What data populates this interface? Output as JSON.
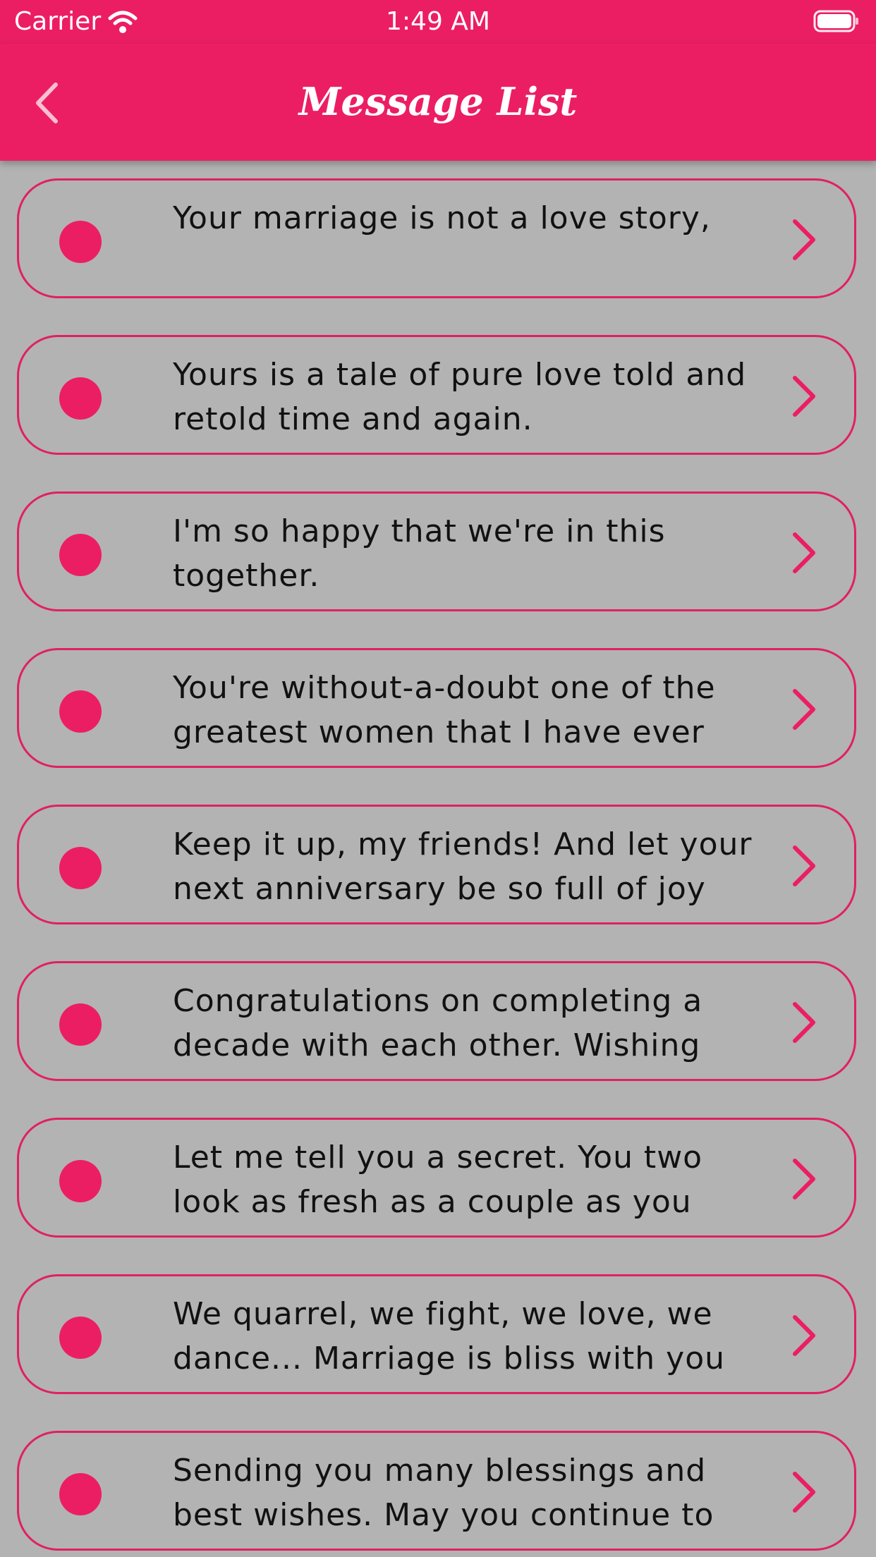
{
  "status_bar": {
    "carrier": "Carrier",
    "time": "1:49 AM",
    "wifi_icon": "wifi-icon",
    "battery_icon": "battery-icon"
  },
  "nav": {
    "title": "Message List",
    "back_icon": "chevron-left-icon"
  },
  "colors": {
    "accent": "#ec1e63",
    "background": "#b3b3b3",
    "text": "#111111"
  },
  "messages": [
    {
      "text": "Your marriage is not a love story,"
    },
    {
      "text": "Yours is a tale of pure love told and retold time and again."
    },
    {
      "text": "I'm so happy that we're in this together."
    },
    {
      "text": "You're without-a-doubt one of the greatest women that I have ever"
    },
    {
      "text": "Keep it up, my friends! And let your next anniversary be so full of joy"
    },
    {
      "text": "Congratulations on completing a decade with each other. Wishing"
    },
    {
      "text": "Let me tell you a secret. You two look as fresh as a couple as you"
    },
    {
      "text": "We quarrel, we fight, we love, we dance... Marriage is bliss with you"
    },
    {
      "text": "Sending you many blessings and best wishes. May you continue to"
    }
  ]
}
